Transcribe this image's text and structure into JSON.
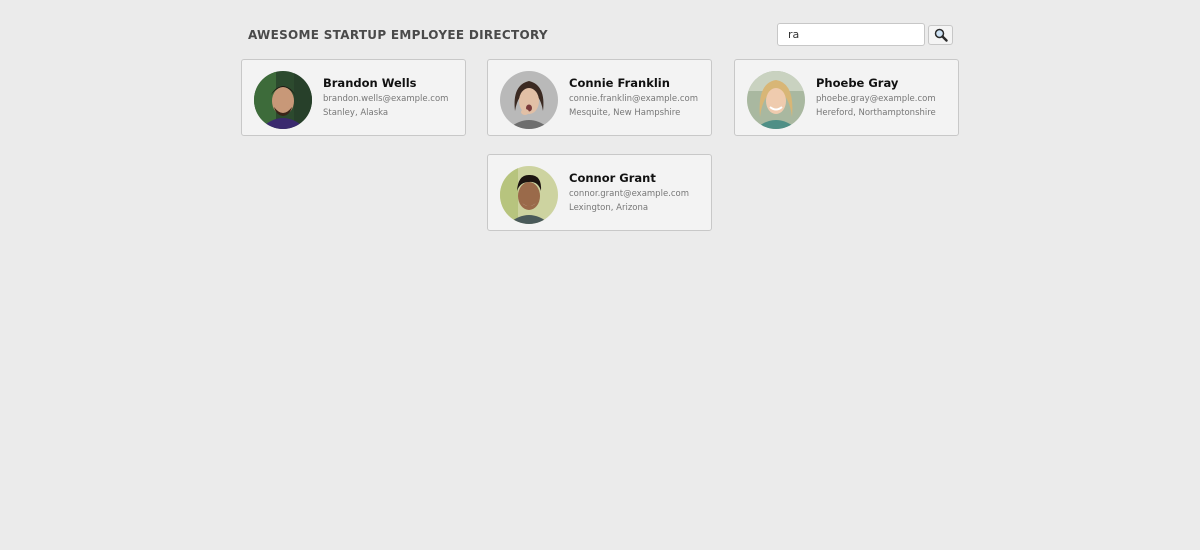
{
  "header": {
    "title": "AWESOME STARTUP EMPLOYEE DIRECTORY"
  },
  "search": {
    "value": "ra",
    "button_icon": "magnifier-icon"
  },
  "employees": [
    {
      "name": "Brandon Wells",
      "email": "brandon.wells@example.com",
      "location": "Stanley, Alaska"
    },
    {
      "name": "Connie Franklin",
      "email": "connie.franklin@example.com",
      "location": "Mesquite, New Hampshire"
    },
    {
      "name": "Phoebe Gray",
      "email": "phoebe.gray@example.com",
      "location": "Hereford, Northamptonshire"
    },
    {
      "name": "Connor Grant",
      "email": "connor.grant@example.com",
      "location": "Lexington, Arizona"
    }
  ]
}
